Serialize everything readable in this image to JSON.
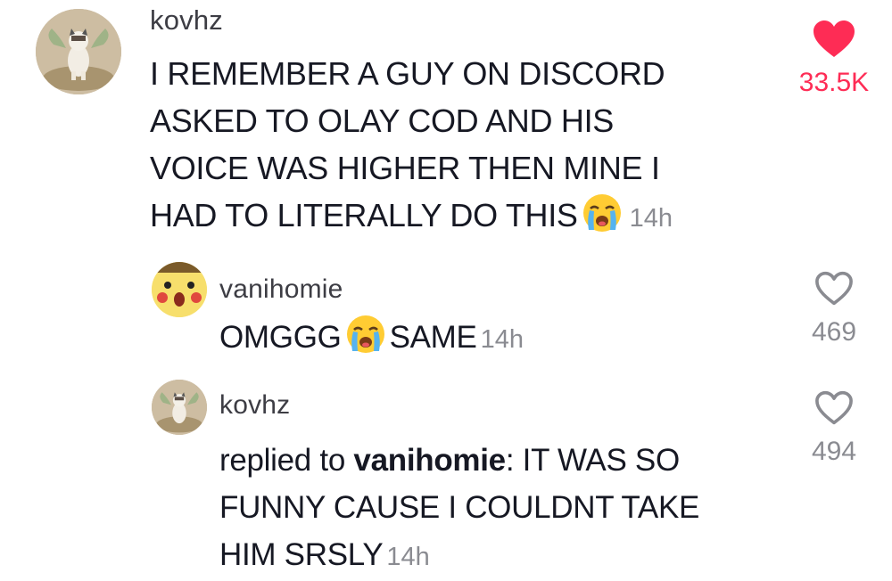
{
  "main_comment": {
    "username": "kovhz",
    "lines": [
      "I REMEMBER A GUY ON DISCORD",
      "ASKED TO OLAY COD AND HIS",
      "VOICE WAS HIGHER THEN MINE I",
      "HAD TO LITERALLY DO THIS"
    ],
    "time": "14h",
    "likes": "33.5K",
    "liked": true,
    "like_color": "#fe2c55",
    "icon": "heart-filled-icon"
  },
  "reply_1": {
    "username": "vanihomie",
    "text_before_emoji": "OMGGG",
    "text_after_emoji": "SAME",
    "time": "14h",
    "likes": "469",
    "icon": "heart-outline-icon"
  },
  "reply_2": {
    "username": "kovhz",
    "replied_prefix": "replied to",
    "replied_to": "vanihomie",
    "lines": [
      ": IT WAS SO",
      "FUNNY CAUSE I COULDNT TAKE",
      "HIM SRSLY"
    ],
    "time": "14h",
    "likes": "494",
    "icon": "heart-outline-icon"
  },
  "emoji_name": "loudly-crying-face-icon"
}
